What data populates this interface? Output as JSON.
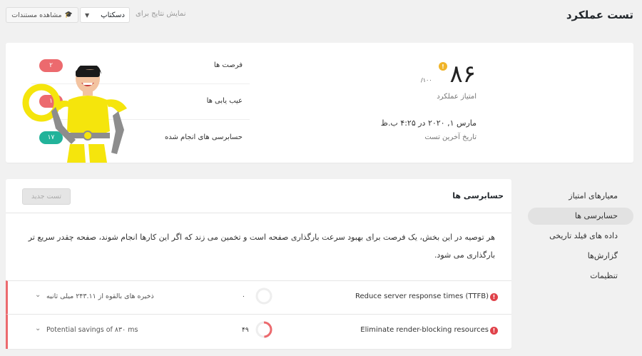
{
  "header": {
    "title": "تست عملکرد",
    "view_label": "نمایش نتایج برای",
    "device_selected": "دسکتاپ",
    "docs_button": "مشاهده مستندات"
  },
  "score": {
    "value": "۸۶",
    "badge": "!",
    "max": "/۱۰۰",
    "label": "امتیاز عملکرد",
    "date": "مارس ۱, ۲۰۲۰ در ۴:۲۵ ب.ظ",
    "date_label": "تاریخ آخرین تست"
  },
  "stats": [
    {
      "label": "فرصت ها",
      "count": "۲",
      "color": "#ec6a6e"
    },
    {
      "label": "عیب یابی ها",
      "count": "۱",
      "color": "#ec6a6e"
    },
    {
      "label": "حسابرسی های انجام شده",
      "count": "۱۷",
      "color": "#22b39a"
    }
  ],
  "sidebar": {
    "items": [
      {
        "label": "معیارهای امتیاز"
      },
      {
        "label": "حسابرسی ها",
        "active": true
      },
      {
        "label": "داده های فیلد تاریخی"
      },
      {
        "label": "گزارش‌ها"
      },
      {
        "label": "تنظیمات"
      }
    ]
  },
  "audits": {
    "title": "حسابرسی ها",
    "new_test_button": "تست جدید",
    "description": "هر توصیه در این بخش، یک فرصت برای بهبود سرعت بارگذاری صفحه است و تخمین می زند که اگر این کارها انجام شوند، صفحه چقدر سریع تر بارگذاری می شود.",
    "rows": [
      {
        "title": "Reduce server response times (TTFB)",
        "score": "۰",
        "savings": "ذخیره های بالقوه از ۲۴۳.۱۱ میلی ثانیه",
        "gauge": 0
      },
      {
        "title": "Eliminate render-blocking resources",
        "score": "۴۹",
        "savings": "Potential savings of ۸۳۰ ms",
        "gauge": 0.49
      }
    ]
  },
  "colors": {
    "accent_red": "#ec6a6e",
    "accent_green": "#22b39a",
    "score_badge": "#f0b429"
  }
}
